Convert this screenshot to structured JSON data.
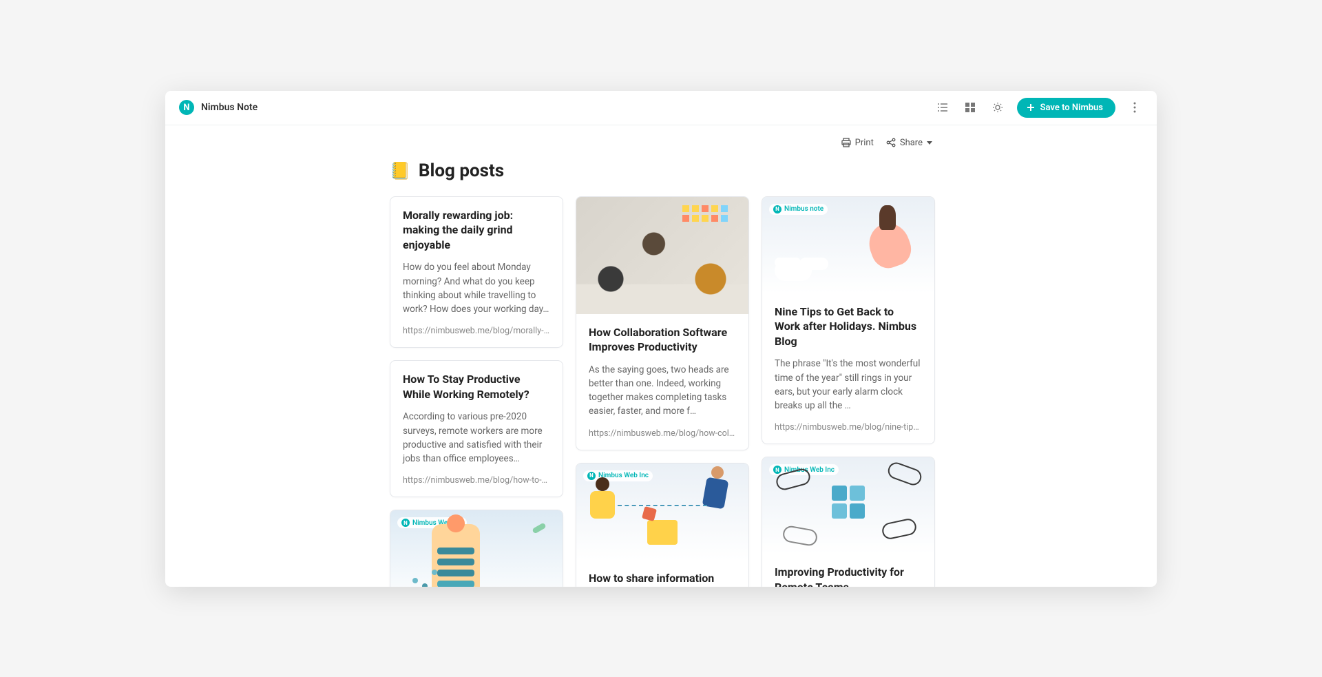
{
  "app": {
    "name": "Nimbus Note"
  },
  "header": {
    "save_label": "Save to Nimbus"
  },
  "toolbar": {
    "print": "Print",
    "share": "Share"
  },
  "page": {
    "icon": "📒",
    "title": "Blog posts"
  },
  "badges": {
    "nimbusnote": "Nimbus note",
    "nimbusweb": "Nimbus Web Inc"
  },
  "cards": {
    "col1": [
      {
        "title": "Morally rewarding job: making the daily grind enjoyable",
        "desc": "How do you feel about Monday morning? And what do you keep thinking about while travelling to work? How does your working day…",
        "url": "https://nimbusweb.me/blog/morally-rewar…"
      },
      {
        "title": "How To Stay Productive While Working Remotely?",
        "desc": "According to various pre-2020 surveys, remote workers are more productive and satisfied with their jobs than office employees…",
        "url": "https://nimbusweb.me/blog/how-to-stay-p…"
      }
    ],
    "col2": [
      {
        "title": "How Collaboration Software Improves Productivity",
        "desc": "As the saying goes, two heads are better than one. Indeed, working together makes completing tasks easier, faster, and more f…",
        "url": "https://nimbusweb.me/blog/how-collabora…"
      },
      {
        "title": "How to share information with"
      }
    ],
    "col3": [
      {
        "title": "Nine Tips to Get Back to Work after Holidays. Nimbus Blog",
        "desc": "The phrase \"It's the most wonderful time of the year\" still rings in your ears, but your early alarm clock breaks up all the …",
        "url": "https://nimbusweb.me/blog/nine-tips-to-e…"
      },
      {
        "title": "Improving Productivity for Remote Teams"
      }
    ]
  }
}
